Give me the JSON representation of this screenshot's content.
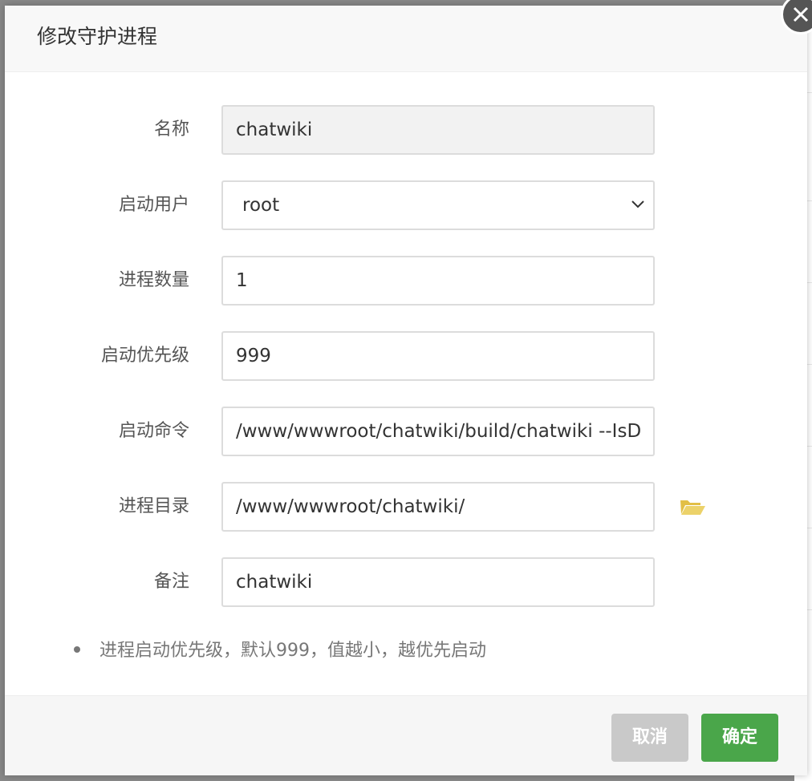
{
  "dialog": {
    "title": "修改守护进程",
    "close_icon": "close-icon"
  },
  "form": {
    "name": {
      "label": "名称",
      "value": "chatwiki",
      "disabled": true
    },
    "user": {
      "label": "启动用户",
      "value": "root"
    },
    "count": {
      "label": "进程数量",
      "value": "1"
    },
    "priority": {
      "label": "启动优先级",
      "value": "999"
    },
    "command": {
      "label": "启动命令",
      "value": "/www/wwwroot/chatwiki/build/chatwiki --IsD"
    },
    "directory": {
      "label": "进程目录",
      "value": "/www/wwwroot/chatwiki/",
      "browse_icon": "folder-open-icon"
    },
    "remark": {
      "label": "备注",
      "value": "chatwiki"
    }
  },
  "tips": [
    "进程启动优先级，默认999，值越小，越优先启动"
  ],
  "footer": {
    "cancel_label": "取消",
    "confirm_label": "确定"
  },
  "colors": {
    "confirm": "#4aa64a",
    "cancel": "#c9c9c9",
    "folder": "#e8c94a"
  }
}
